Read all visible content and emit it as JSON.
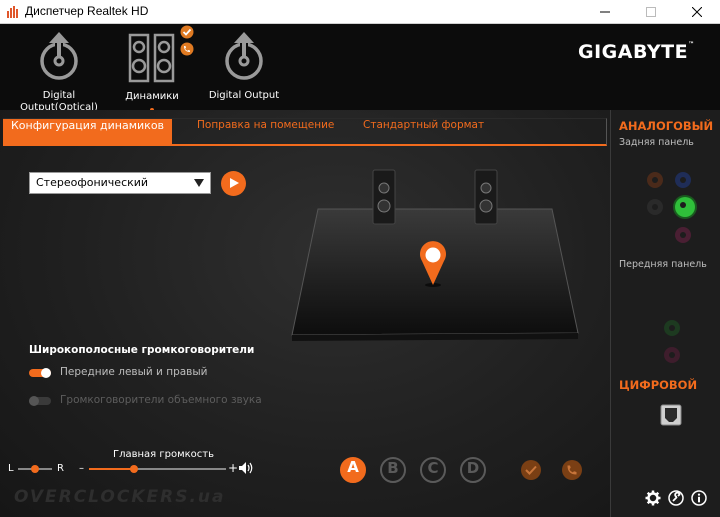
{
  "window": {
    "title": "Диспетчер Realtek HD"
  },
  "devices": [
    {
      "label": "Digital Output(Optical)",
      "icon": "digital-optical-output-icon",
      "selected": false
    },
    {
      "label": "Динамики",
      "icon": "speakers-icon",
      "selected": true
    },
    {
      "label": "Digital Output",
      "icon": "digital-output-icon",
      "selected": false
    }
  ],
  "brand": "GIGABYTE",
  "tabs": [
    {
      "label": "Конфигурация динамиков",
      "active": true
    },
    {
      "label": "Поправка на помещение",
      "active": false
    },
    {
      "label": "Стандартный формат",
      "active": false
    }
  ],
  "config": {
    "selected_mode": "Стереофонический",
    "wideband_title": "Широкополосные громкоговорители",
    "front_lr_label": "Передние левый и правый",
    "front_lr_enabled": true,
    "surround_label": "Громкоговорители объемного звука",
    "surround_enabled": false
  },
  "volume": {
    "title": "Главная громкость",
    "left_label": "L",
    "right_label": "R",
    "minus": "–",
    "plus": "+",
    "balance": 0.5,
    "level": 0.33
  },
  "profiles": [
    "A",
    "B",
    "C",
    "D"
  ],
  "active_profile": "A",
  "side_panel": {
    "analog_heading": "АНАЛОГОВЫЙ",
    "rear_panel": "Задняя панель",
    "front_panel": "Передняя панель",
    "digital_heading": "ЦИФРОВОЙ"
  },
  "watermark": "OVERCLOCKERS.ua",
  "colors": {
    "accent": "#f26b1d",
    "jack_green": "#2fbf3a",
    "jack_blue": "#2b4fa8",
    "jack_pink": "#c83a6a",
    "jack_orange": "#d5701f"
  }
}
